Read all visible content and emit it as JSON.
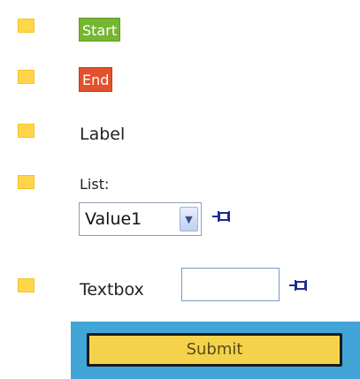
{
  "items": {
    "start_badge": "Start",
    "end_badge": "End",
    "label_text": "Label",
    "list_caption": "List:",
    "list_selected_value": "Value1",
    "textbox_caption": "Textbox",
    "textbox_value": ""
  },
  "submit_label": "Submit",
  "icons": {
    "bullet": "square-bullet-icon",
    "dropdown": "chevron-down-icon",
    "pin": "pin-icon"
  },
  "colors": {
    "bullet": "#ffd54a",
    "start_badge": "#76b632",
    "end_badge": "#e3512d",
    "submit_panel": "#42a5d8",
    "submit_button": "#f4d24c"
  }
}
